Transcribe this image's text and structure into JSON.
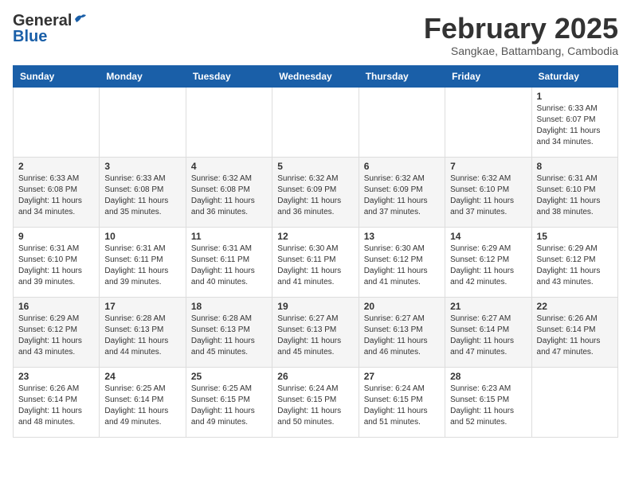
{
  "logo": {
    "general": "General",
    "blue": "Blue"
  },
  "title": "February 2025",
  "location": "Sangkae, Battambang, Cambodia",
  "days": [
    "Sunday",
    "Monday",
    "Tuesday",
    "Wednesday",
    "Thursday",
    "Friday",
    "Saturday"
  ],
  "weeks": [
    [
      {
        "day": "",
        "content": ""
      },
      {
        "day": "",
        "content": ""
      },
      {
        "day": "",
        "content": ""
      },
      {
        "day": "",
        "content": ""
      },
      {
        "day": "",
        "content": ""
      },
      {
        "day": "",
        "content": ""
      },
      {
        "day": "1",
        "content": "Sunrise: 6:33 AM\nSunset: 6:07 PM\nDaylight: 11 hours\nand 34 minutes."
      }
    ],
    [
      {
        "day": "2",
        "content": "Sunrise: 6:33 AM\nSunset: 6:08 PM\nDaylight: 11 hours\nand 34 minutes."
      },
      {
        "day": "3",
        "content": "Sunrise: 6:33 AM\nSunset: 6:08 PM\nDaylight: 11 hours\nand 35 minutes."
      },
      {
        "day": "4",
        "content": "Sunrise: 6:32 AM\nSunset: 6:08 PM\nDaylight: 11 hours\nand 36 minutes."
      },
      {
        "day": "5",
        "content": "Sunrise: 6:32 AM\nSunset: 6:09 PM\nDaylight: 11 hours\nand 36 minutes."
      },
      {
        "day": "6",
        "content": "Sunrise: 6:32 AM\nSunset: 6:09 PM\nDaylight: 11 hours\nand 37 minutes."
      },
      {
        "day": "7",
        "content": "Sunrise: 6:32 AM\nSunset: 6:10 PM\nDaylight: 11 hours\nand 37 minutes."
      },
      {
        "day": "8",
        "content": "Sunrise: 6:31 AM\nSunset: 6:10 PM\nDaylight: 11 hours\nand 38 minutes."
      }
    ],
    [
      {
        "day": "9",
        "content": "Sunrise: 6:31 AM\nSunset: 6:10 PM\nDaylight: 11 hours\nand 39 minutes."
      },
      {
        "day": "10",
        "content": "Sunrise: 6:31 AM\nSunset: 6:11 PM\nDaylight: 11 hours\nand 39 minutes."
      },
      {
        "day": "11",
        "content": "Sunrise: 6:31 AM\nSunset: 6:11 PM\nDaylight: 11 hours\nand 40 minutes."
      },
      {
        "day": "12",
        "content": "Sunrise: 6:30 AM\nSunset: 6:11 PM\nDaylight: 11 hours\nand 41 minutes."
      },
      {
        "day": "13",
        "content": "Sunrise: 6:30 AM\nSunset: 6:12 PM\nDaylight: 11 hours\nand 41 minutes."
      },
      {
        "day": "14",
        "content": "Sunrise: 6:29 AM\nSunset: 6:12 PM\nDaylight: 11 hours\nand 42 minutes."
      },
      {
        "day": "15",
        "content": "Sunrise: 6:29 AM\nSunset: 6:12 PM\nDaylight: 11 hours\nand 43 minutes."
      }
    ],
    [
      {
        "day": "16",
        "content": "Sunrise: 6:29 AM\nSunset: 6:12 PM\nDaylight: 11 hours\nand 43 minutes."
      },
      {
        "day": "17",
        "content": "Sunrise: 6:28 AM\nSunset: 6:13 PM\nDaylight: 11 hours\nand 44 minutes."
      },
      {
        "day": "18",
        "content": "Sunrise: 6:28 AM\nSunset: 6:13 PM\nDaylight: 11 hours\nand 45 minutes."
      },
      {
        "day": "19",
        "content": "Sunrise: 6:27 AM\nSunset: 6:13 PM\nDaylight: 11 hours\nand 45 minutes."
      },
      {
        "day": "20",
        "content": "Sunrise: 6:27 AM\nSunset: 6:13 PM\nDaylight: 11 hours\nand 46 minutes."
      },
      {
        "day": "21",
        "content": "Sunrise: 6:27 AM\nSunset: 6:14 PM\nDaylight: 11 hours\nand 47 minutes."
      },
      {
        "day": "22",
        "content": "Sunrise: 6:26 AM\nSunset: 6:14 PM\nDaylight: 11 hours\nand 47 minutes."
      }
    ],
    [
      {
        "day": "23",
        "content": "Sunrise: 6:26 AM\nSunset: 6:14 PM\nDaylight: 11 hours\nand 48 minutes."
      },
      {
        "day": "24",
        "content": "Sunrise: 6:25 AM\nSunset: 6:14 PM\nDaylight: 11 hours\nand 49 minutes."
      },
      {
        "day": "25",
        "content": "Sunrise: 6:25 AM\nSunset: 6:15 PM\nDaylight: 11 hours\nand 49 minutes."
      },
      {
        "day": "26",
        "content": "Sunrise: 6:24 AM\nSunset: 6:15 PM\nDaylight: 11 hours\nand 50 minutes."
      },
      {
        "day": "27",
        "content": "Sunrise: 6:24 AM\nSunset: 6:15 PM\nDaylight: 11 hours\nand 51 minutes."
      },
      {
        "day": "28",
        "content": "Sunrise: 6:23 AM\nSunset: 6:15 PM\nDaylight: 11 hours\nand 52 minutes."
      },
      {
        "day": "",
        "content": ""
      }
    ]
  ]
}
